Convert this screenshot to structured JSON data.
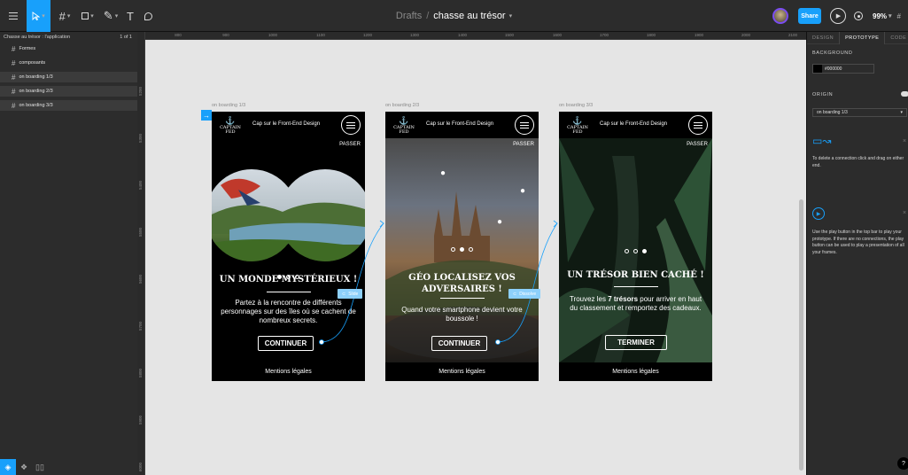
{
  "toolbar": {
    "menu_icon": "hamburger-icon",
    "tools": [
      "move-tool",
      "frame-tool",
      "shape-tool",
      "pen-tool",
      "text-tool",
      "comment-tool"
    ],
    "text_tool_glyph": "T",
    "breadcrumb_parent": "Drafts",
    "breadcrumb_sep": "/",
    "file_name": "chasse au trésor",
    "share_label": "Share",
    "zoom_label": "99%"
  },
  "left_panel": {
    "page_name": "Chasse au trésor : l'application",
    "page_count": "1 of 1",
    "layers": [
      {
        "label": "Formes"
      },
      {
        "label": "composants"
      },
      {
        "label": "on boarding 1/3"
      },
      {
        "label": "on boarding 2/3"
      },
      {
        "label": "on boarding 3/3"
      }
    ]
  },
  "rulers": {
    "top": [
      "800",
      "900",
      "1000",
      "1100",
      "1200",
      "1300",
      "1400",
      "1500",
      "1600",
      "1700",
      "1800",
      "1900",
      "2000",
      "2100"
    ],
    "left": [
      "5200",
      "5300",
      "5400",
      "5500",
      "5600",
      "5700",
      "5800",
      "5900",
      "6000"
    ]
  },
  "frames": [
    {
      "label": "on boarding 1/3",
      "tagline": "Cap sur le Front-End Design",
      "logo_top": "CAPTAIN",
      "logo_bottom": "FED",
      "skip": "PASSER",
      "title": "UN MONDE MYSTÉRIEUX !",
      "text": "Partez à la rencontre de différents personnages sur des îles où se cachent de nombreux secrets.",
      "cta": "CONTINUER",
      "footer": "Mentions légales",
      "active_dot": 0
    },
    {
      "label": "on boarding 2/3",
      "tagline": "Cap sur le Front-End Design",
      "logo_top": "CAPTAIN",
      "logo_bottom": "FED",
      "skip": "PASSER",
      "title": "GÉO LOCALISEZ VOS ADVERSAIRES !",
      "text": "Quand votre smartphone devient votre boussole !",
      "cta": "CONTINUER",
      "footer": "Mentions légales",
      "active_dot": 1
    },
    {
      "label": "on boarding 3/3",
      "tagline": "Cap sur le Front-End Design",
      "logo_top": "CAPTAIN",
      "logo_bottom": "FED",
      "skip": "PASSER",
      "title": "UN TRÉSOR BIEN CACHÉ !",
      "text_before": "Trouvez les ",
      "text_bold": "7 trésors",
      "text_after": " pour arriver en haut du classement et remportez des cadeaux.",
      "cta": "TERMINER",
      "footer": "Mentions légales",
      "active_dot": 2
    }
  ],
  "connections": [
    {
      "label": "Slide"
    },
    {
      "label": "Dissolve"
    }
  ],
  "right_panel": {
    "tabs": [
      "DESIGN",
      "PROTOTYPE",
      "CODE"
    ],
    "active_tab": "PROTOTYPE",
    "background_title": "BACKGROUND",
    "background_value": "#000000",
    "origin_title": "ORIGIN",
    "origin_value": "on boarding 1/3",
    "hint_connection": "To delete a connection click and drag on either end.",
    "hint_play": "Use the play button in the top bar to play your prototype. If there are no connections, the play button can be used to play a presentation of all your frames.",
    "help": "?"
  },
  "colors": {
    "accent": "#18a0fb",
    "canvas": "#e5e5e5",
    "panel": "#2c2c2c"
  }
}
